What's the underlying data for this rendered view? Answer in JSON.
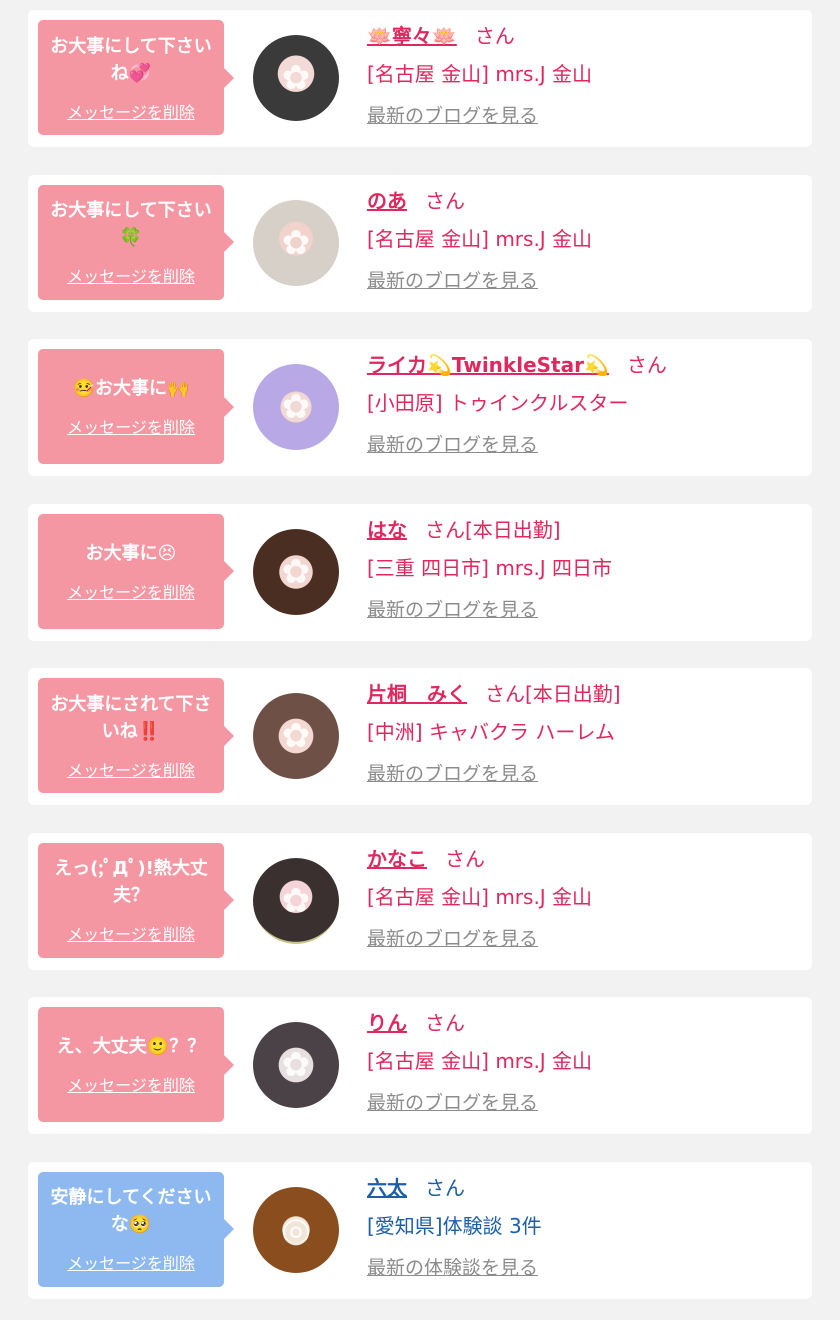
{
  "colors": {
    "page_background": "#f2f2f2",
    "card_background": "#ffffff",
    "pink_bubble": "#f497a2",
    "blue_bubble": "#8eb8f0",
    "pink_text": "#e0285e",
    "blue_text": "#1d5ea8",
    "link_gray": "#8c8c8c"
  },
  "delete_label": "メッセージを削除",
  "cards": [
    {
      "bubble_color": "pink",
      "message": "お大事にして下さいね💞",
      "avatar_icon": "woman-photo-icon",
      "name": "🪷寧々🪷",
      "suffix": "さん",
      "shop": "[名古屋 金山] mrs.J 金山",
      "link": "最新のブログを見る"
    },
    {
      "bubble_color": "pink",
      "message": "お大事にして下さい🍀",
      "avatar_icon": "woman-photo-icon",
      "name": "のあ",
      "suffix": "さん",
      "shop": "[名古屋 金山] mrs.J 金山",
      "link": "最新のブログを見る"
    },
    {
      "bubble_color": "pink",
      "message": "🤒お大事に🙌",
      "avatar_icon": "woman-photo-icon",
      "name": "ライカ💫TwinkleStar💫",
      "suffix": "さん",
      "shop": "[小田原] トゥインクルスター",
      "link": "最新のブログを見る"
    },
    {
      "bubble_color": "pink",
      "message": "お大事に😣",
      "avatar_icon": "woman-photo-icon",
      "name": "はな",
      "suffix": "さん[本日出勤]",
      "shop": "[三重 四日市] mrs.J 四日市",
      "link": "最新のブログを見る"
    },
    {
      "bubble_color": "pink",
      "message": "お大事にされて下さいね‼️",
      "avatar_icon": "woman-photo-icon",
      "name": "片桐　みく",
      "suffix": "さん[本日出勤]",
      "shop": "[中洲] キャバクラ ハーレム",
      "link": "最新のブログを見る"
    },
    {
      "bubble_color": "pink",
      "message": "えっ(;ﾟДﾟ)!熱大丈夫？",
      "avatar_icon": "woman-photo-icon",
      "name": "かなこ",
      "suffix": "さん",
      "shop": "[名古屋 金山] mrs.J 金山",
      "link": "最新のブログを見る"
    },
    {
      "bubble_color": "pink",
      "message": "え、大丈夫🙂？？",
      "avatar_icon": "woman-photo-icon",
      "name": "りん",
      "suffix": "さん",
      "shop": "[名古屋 金山] mrs.J 金山",
      "link": "最新のブログを見る"
    },
    {
      "bubble_color": "blue",
      "message": "安静にしてくださいな🥺",
      "avatar_icon": "food-photo-icon",
      "name": "六太",
      "suffix": "さん",
      "shop": "[愛知県]体験談 3件",
      "link": "最新の体験談を見る"
    }
  ]
}
